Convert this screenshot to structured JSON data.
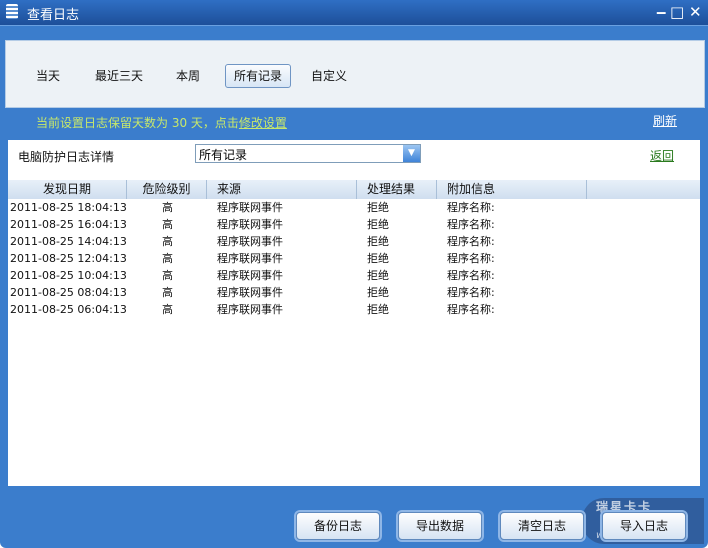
{
  "window": {
    "title": "查看日志",
    "minimize": "‒",
    "maximize": "□",
    "close": "✕"
  },
  "tabs": [
    {
      "label": "当天"
    },
    {
      "label": "最近三天"
    },
    {
      "label": "本周"
    },
    {
      "label": "所有记录",
      "selected": true
    },
    {
      "label": "自定义"
    }
  ],
  "notice": {
    "text": "当前设置日志保留天数为 30 天，点击",
    "link": "修改设置"
  },
  "refresh": "刷新",
  "detail": {
    "label": "电脑防护日志详情",
    "filter": "所有记录",
    "back": "返回"
  },
  "columns": [
    "发现日期",
    "危险级别",
    "来源",
    "处理结果",
    "附加信息",
    ""
  ],
  "rows": [
    [
      "2011-08-25 18:04:13",
      "高",
      "程序联网事件",
      "拒绝",
      "程序名称:"
    ],
    [
      "2011-08-25 16:04:13",
      "高",
      "程序联网事件",
      "拒绝",
      "程序名称:"
    ],
    [
      "2011-08-25 14:04:13",
      "高",
      "程序联网事件",
      "拒绝",
      "程序名称:"
    ],
    [
      "2011-08-25 12:04:13",
      "高",
      "程序联网事件",
      "拒绝",
      "程序名称:"
    ],
    [
      "2011-08-25 10:04:13",
      "高",
      "程序联网事件",
      "拒绝",
      "程序名称:"
    ],
    [
      "2011-08-25 08:04:13",
      "高",
      "程序联网事件",
      "拒绝",
      "程序名称:"
    ],
    [
      "2011-08-25 06:04:13",
      "高",
      "程序联网事件",
      "拒绝",
      "程序名称:"
    ]
  ],
  "buttons": {
    "backup": "备份日志",
    "export": "导出数据",
    "clear": "清空日志",
    "import": "导入日志"
  },
  "watermark": {
    "brand": "瑞星卡卡",
    "url": "www.ikaka.com"
  }
}
